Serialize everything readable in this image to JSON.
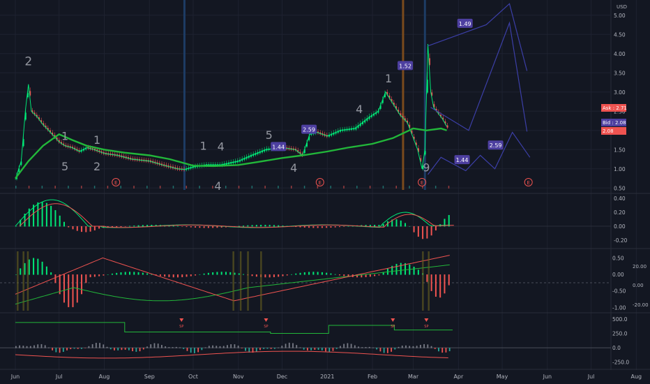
{
  "currency": "USD",
  "colors": {
    "bg": "#131722",
    "grid": "#1e2230",
    "axis_text": "#b2b5be",
    "up": "#26a69a",
    "bright_up": "#00e676",
    "down": "#ef5350",
    "ma": "#22b73a",
    "projection": "#3c3fa8",
    "label_bg": "#4d3fa0",
    "ask": "#ef5350",
    "bid": "#4d3fa0"
  },
  "price_pane": {
    "price_ticks": [
      "5.00",
      "4.50",
      "4.00",
      "3.50",
      "3.00",
      "2.50",
      "2.00",
      "1.50",
      "1.00",
      "0.50"
    ],
    "ylim": [
      0.45,
      5.25
    ],
    "ask_label": "Ask : 2.71",
    "bid_label": "Bid : 2.08",
    "last_label": "2.08",
    "earnings_marker": "E"
  },
  "month_labels": [
    "Jun",
    "Jul",
    "Aug",
    "Sep",
    "Oct",
    "Nov",
    "Dec",
    "2021",
    "Feb",
    "Mar",
    "Apr",
    "May",
    "Jun",
    "Jul",
    "Aug"
  ],
  "macd_pane": {
    "ticks": [
      "0.40",
      "0.20",
      "0.00",
      "-0.20"
    ],
    "ylim": [
      -0.28,
      0.42
    ]
  },
  "osc_pane": {
    "left_ticks": [
      "0.50",
      "0.00",
      "-0.50",
      "-1.00"
    ],
    "right_ticks": [
      "20.00",
      "0.00",
      "-20.00"
    ],
    "ylim": [
      -1.1,
      0.7
    ]
  },
  "vol_pane": {
    "ticks": [
      "500.0",
      "250.0",
      "0.0",
      "-250.0"
    ],
    "ylim": [
      -290,
      560
    ],
    "marker_text": "SP"
  },
  "seq_labels": [
    {
      "text": "2",
      "d": "2020-06-10",
      "p": 3.7,
      "size": 17
    },
    {
      "text": "1",
      "d": "2020-07-05",
      "p": 1.75,
      "size": 16
    },
    {
      "text": "5",
      "d": "2020-07-05",
      "p": 0.96,
      "size": 16
    },
    {
      "text": "1",
      "d": "2020-07-27",
      "p": 1.65,
      "size": 16
    },
    {
      "text": "2",
      "d": "2020-07-27",
      "p": 0.96,
      "size": 16
    },
    {
      "text": "1",
      "d": "2020-10-08",
      "p": 1.5,
      "size": 16
    },
    {
      "text": "4",
      "d": "2020-10-20",
      "p": 1.48,
      "size": 16
    },
    {
      "text": "4",
      "d": "2020-10-18",
      "p": 0.45,
      "size": 16
    },
    {
      "text": "5",
      "d": "2020-11-22",
      "p": 1.78,
      "size": 16
    },
    {
      "text": "4",
      "d": "2020-12-09",
      "p": 0.92,
      "size": 16
    },
    {
      "text": "4",
      "d": "2021-01-23",
      "p": 2.45,
      "size": 16
    },
    {
      "text": "1",
      "d": "2021-02-12",
      "p": 3.25,
      "size": 16
    },
    {
      "text": "9",
      "d": "2021-03-10",
      "p": 0.93,
      "size": 16
    }
  ],
  "labels": [
    {
      "text": "1.44",
      "d": "2020-11-28",
      "p": 1.57
    },
    {
      "text": "2.59",
      "d": "2020-12-19",
      "p": 2.02
    },
    {
      "text": "1.52",
      "d": "2021-02-23",
      "p": 3.68
    },
    {
      "text": "1.49",
      "d": "2021-04-05",
      "p": 4.78
    },
    {
      "text": "1.44",
      "d": "2021-04-03",
      "p": 1.23
    },
    {
      "text": "2.59",
      "d": "2021-04-26",
      "p": 1.61
    }
  ],
  "earnings_dates": [
    "2020-08-09",
    "2020-12-27",
    "2021-03-07",
    "2021-05-19"
  ],
  "vertical_lines": [
    {
      "d": "2020-09-25",
      "color": "#1d3c64"
    },
    {
      "d": "2021-02-22",
      "color": "#7a4a1c"
    },
    {
      "d": "2021-03-09",
      "color": "#1d3c64"
    }
  ],
  "chart_data": {
    "type": "line",
    "title": "",
    "xlabel": "",
    "ylabel": "",
    "x_axis": "date",
    "ylim": [
      0.45,
      5.25
    ],
    "grid": true,
    "series": [
      {
        "x": [
          "2020-06-01",
          "2020-06-05",
          "2020-06-08",
          "2020-06-10",
          "2020-06-12",
          "2020-06-16",
          "2020-06-20",
          "2020-06-25",
          "2020-07-01",
          "2020-07-05",
          "2020-07-10",
          "2020-07-15",
          "2020-07-20",
          "2020-07-25",
          "2020-08-01",
          "2020-08-10",
          "2020-08-20",
          "2020-09-01",
          "2020-09-10",
          "2020-09-20",
          "2020-09-25",
          "2020-10-01",
          "2020-10-10",
          "2020-10-20",
          "2020-11-01",
          "2020-11-10",
          "2020-11-20",
          "2020-12-01",
          "2020-12-10",
          "2020-12-15",
          "2020-12-20",
          "2020-12-25",
          "2021-01-01",
          "2021-01-10",
          "2021-01-20",
          "2021-01-30",
          "2021-02-05",
          "2021-02-10",
          "2021-02-15",
          "2021-02-20",
          "2021-02-25",
          "2021-03-01",
          "2021-03-04",
          "2021-03-07",
          "2021-03-09",
          "2021-03-11",
          "2021-03-13",
          "2021-03-15",
          "2021-03-18",
          "2021-03-21",
          "2021-03-24"
        ],
        "values": [
          0.72,
          1.2,
          2.55,
          3.2,
          2.5,
          2.35,
          2.15,
          1.95,
          1.7,
          1.6,
          1.55,
          1.45,
          1.55,
          1.5,
          1.4,
          1.35,
          1.25,
          1.2,
          1.1,
          1.0,
          0.98,
          1.05,
          1.1,
          1.1,
          1.2,
          1.35,
          1.5,
          1.55,
          1.5,
          1.35,
          1.9,
          1.95,
          1.85,
          2.0,
          2.05,
          2.35,
          2.5,
          3.0,
          2.7,
          2.4,
          2.2,
          1.8,
          1.5,
          1.0,
          1.5,
          4.25,
          3.0,
          2.6,
          2.45,
          2.3,
          2.1
        ]
      },
      {
        "x": [
          "2020-06-01",
          "2020-06-10",
          "2020-06-20",
          "2020-07-01",
          "2020-07-10",
          "2020-07-20",
          "2020-08-01",
          "2020-08-15",
          "2020-09-01",
          "2020-09-15",
          "2020-10-01",
          "2020-10-15",
          "2020-11-01",
          "2020-11-15",
          "2020-12-01",
          "2020-12-15",
          "2021-01-01",
          "2021-01-15",
          "2021-02-01",
          "2021-02-15",
          "2021-03-01",
          "2021-03-10",
          "2021-03-20",
          "2021-03-24"
        ],
        "values": [
          0.75,
          1.2,
          1.6,
          1.9,
          1.75,
          1.6,
          1.5,
          1.42,
          1.35,
          1.25,
          1.08,
          1.07,
          1.1,
          1.18,
          1.28,
          1.35,
          1.45,
          1.55,
          1.65,
          1.8,
          2.05,
          2.0,
          2.05,
          2.0
        ]
      },
      {
        "x": [
          "2021-03-11",
          "2021-04-20",
          "2021-05-06",
          "2021-05-18"
        ],
        "values": [
          4.2,
          4.75,
          5.3,
          3.55
        ]
      },
      {
        "x": [
          "2021-03-13",
          "2021-04-08",
          "2021-05-06",
          "2021-05-18"
        ],
        "values": [
          2.6,
          2.0,
          4.8,
          1.97
        ]
      },
      {
        "x": [
          "2021-03-11",
          "2021-03-20",
          "2021-04-06",
          "2021-04-16",
          "2021-04-26",
          "2021-05-08",
          "2021-05-20"
        ],
        "values": [
          0.85,
          1.3,
          0.95,
          1.35,
          1.0,
          1.95,
          1.3
        ]
      }
    ]
  }
}
